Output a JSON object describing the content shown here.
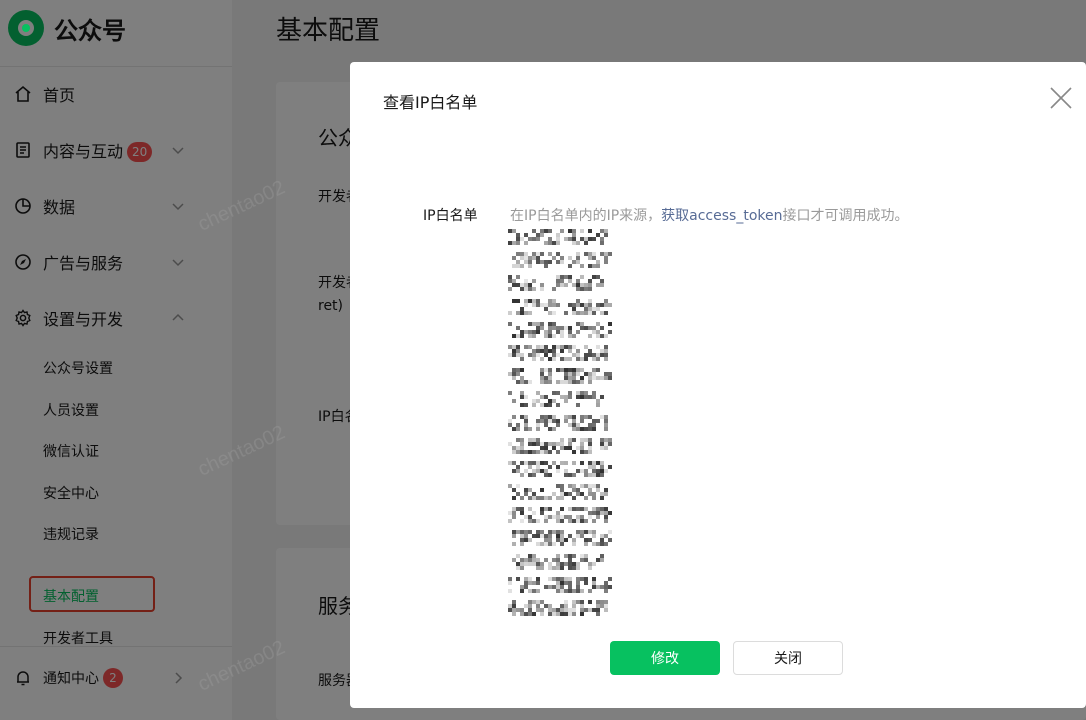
{
  "app": {
    "logo_text": "公众号"
  },
  "sidebar": {
    "items": [
      {
        "label": "首页",
        "icon": "home-icon"
      },
      {
        "label": "内容与互动",
        "icon": "document-icon",
        "badge": "20",
        "chevron": "down"
      },
      {
        "label": "数据",
        "icon": "pie-chart-icon",
        "chevron": "down"
      },
      {
        "label": "广告与服务",
        "icon": "compass-icon",
        "chevron": "down"
      },
      {
        "label": "设置与开发",
        "icon": "gear-icon",
        "chevron": "up"
      }
    ],
    "subitems": [
      "公众号设置",
      "人员设置",
      "微信认证",
      "安全中心",
      "违规记录"
    ],
    "active_subitem": "基本配置",
    "extra_subitem": "开发者工具",
    "notifications": {
      "label": "通知中心",
      "badge": "2",
      "icon": "bell-icon"
    }
  },
  "main": {
    "page_title": "基本配置",
    "card1": {
      "title": "公众",
      "labels": [
        "开发者",
        "开发者",
        "ret)",
        "IP白名"
      ]
    },
    "card2": {
      "title": "服务",
      "labels": [
        "服务器"
      ]
    }
  },
  "watermark": "chentao02",
  "modal": {
    "title": "查看IP白名单",
    "field_label": "IP白名单",
    "description_prefix": "在IP白名单内的IP来源，",
    "description_link": "获取access_token",
    "description_suffix": "接口才可调用成功。",
    "ip_count": 17,
    "buttons": {
      "primary": "修改",
      "secondary": "关闭"
    }
  },
  "colors": {
    "brand": "#07c160",
    "badge": "#fa5151",
    "highlight": "#e8412c",
    "link": "#576b95"
  }
}
